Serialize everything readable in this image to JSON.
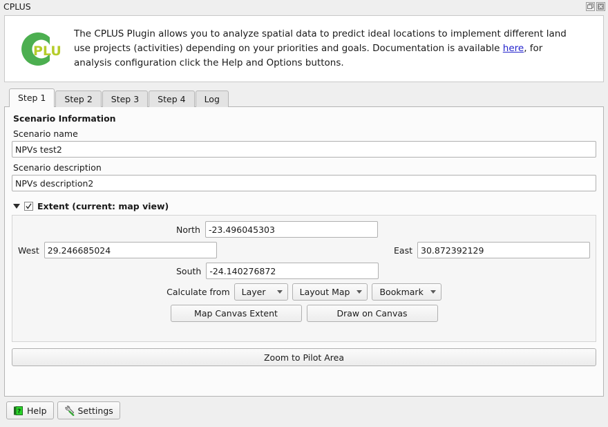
{
  "window": {
    "title": "CPLUS",
    "buttons": [
      {
        "name": "float-button",
        "glyph": "float-icon"
      },
      {
        "name": "close-button",
        "glyph": "close-icon"
      }
    ]
  },
  "banner": {
    "logo_alt": "cplus-logo",
    "logo_text": "PLUS",
    "text_before_link": "The CPLUS Plugin allows you to analyze spatial data to predict ideal locations to implement different land use projects (activities) depending on your priorities and goals. Documentation is available ",
    "link_text": "here",
    "text_after_link": ", for analysis configuration click the Help and Options buttons."
  },
  "tabs": [
    {
      "label": "Step 1",
      "active": true
    },
    {
      "label": "Step 2",
      "active": false
    },
    {
      "label": "Step 3",
      "active": false
    },
    {
      "label": "Step 4",
      "active": false
    },
    {
      "label": "Log",
      "active": false
    }
  ],
  "step1": {
    "section_title": "Scenario Information",
    "scenario_name": {
      "label": "Scenario name",
      "value": "NPVs test2",
      "placeholder": ""
    },
    "scenario_description": {
      "label": "Scenario description",
      "value": "NPVs description2",
      "placeholder": ""
    },
    "extent": {
      "title": "Extent (current: map view)",
      "checked": true,
      "expanded": true,
      "north": {
        "label": "North",
        "value": "-23.496045303"
      },
      "west": {
        "label": "West",
        "value": "29.246685024"
      },
      "east": {
        "label": "East",
        "value": "30.872392129"
      },
      "south": {
        "label": "South",
        "value": "-24.140276872"
      },
      "calculate_from_label": "Calculate from",
      "calculate_from_options": [
        {
          "label": "Layer"
        },
        {
          "label": "Layout Map"
        },
        {
          "label": "Bookmark"
        }
      ],
      "map_canvas_extent_label": "Map Canvas Extent",
      "draw_on_canvas_label": "Draw on Canvas"
    },
    "zoom_pilot_label": "Zoom to Pilot Area"
  },
  "footer": {
    "help_label": "Help",
    "settings_label": "Settings"
  },
  "colors": {
    "logo_ring": "#4caf50",
    "logo_text": "#b5cc2b",
    "link": "#2222cc",
    "window_bg": "#efefef",
    "panel_bg": "#fbfbfb",
    "group_bg": "#f6f6f6",
    "border": "#b4b4b4",
    "help_icon_green": "#29d329"
  }
}
